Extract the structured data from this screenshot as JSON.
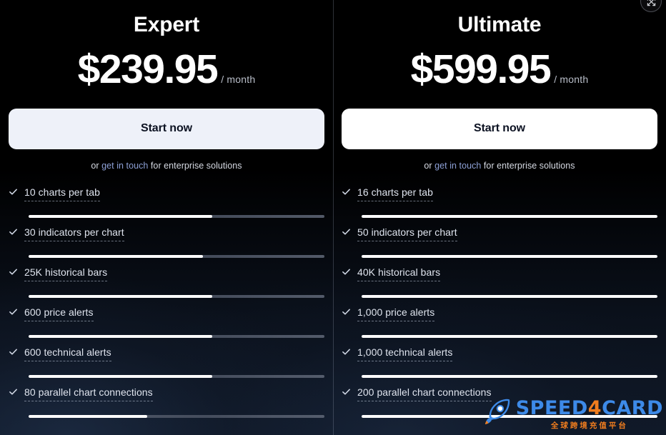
{
  "columns": [
    {
      "id": "expert",
      "title": "Expert",
      "price": "$239.95",
      "period": "/ month",
      "cta_label": "Start now",
      "sub_prefix": "or ",
      "sub_link": "get in touch",
      "sub_suffix": " for enterprise solutions",
      "cta_color": "#eef1f9",
      "features": [
        {
          "label": "10 charts per tab",
          "fill": 62
        },
        {
          "label": "30 indicators per chart",
          "fill": 59
        },
        {
          "label": "25K historical bars",
          "fill": 62
        },
        {
          "label": "600 price alerts",
          "fill": 62
        },
        {
          "label": "600 technical alerts",
          "fill": 62
        },
        {
          "label": "80 parallel chart connections",
          "fill": 40
        }
      ]
    },
    {
      "id": "ultimate",
      "title": "Ultimate",
      "price": "$599.95",
      "period": "/ month",
      "cta_label": "Start now",
      "sub_prefix": "or ",
      "sub_link": "get in touch",
      "sub_suffix": " for enterprise solutions",
      "cta_color": "#ffffff",
      "features": [
        {
          "label": "16 charts per tab",
          "fill": 100
        },
        {
          "label": "50 indicators per chart",
          "fill": 100
        },
        {
          "label": "40K historical bars",
          "fill": 100
        },
        {
          "label": "1,000 price alerts",
          "fill": 100
        },
        {
          "label": "1,000 technical alerts",
          "fill": 100
        },
        {
          "label": "200 parallel chart connections",
          "fill": 100
        }
      ]
    }
  ],
  "corner_control": {
    "icon": "expand-icon"
  },
  "watermark": {
    "icon": "rocket-icon",
    "brand_part1": "SPEED",
    "brand_four": "4",
    "brand_part2": "CARD",
    "subtitle": "全球跨境充值平台",
    "brand_color": "#3d8ae8",
    "accent_color": "#f07d1e"
  },
  "theme": {
    "background": "#000000",
    "link_color": "#8da0d6",
    "text_color": "#dfe4ee"
  }
}
